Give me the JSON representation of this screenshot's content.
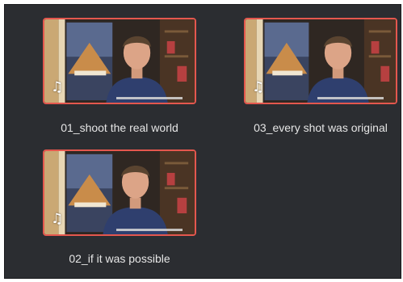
{
  "media_pool": {
    "clips": [
      {
        "name": "01_shoot the real world",
        "audio_icon": "music-note-icon",
        "selected": true
      },
      {
        "name": "03_every shot was original",
        "audio_icon": "music-note-icon",
        "selected": true
      },
      {
        "name": "02_if it was possible",
        "audio_icon": "music-note-icon",
        "selected": true
      }
    ]
  },
  "colors": {
    "panel_bg": "#2b2d31",
    "selection_border": "#e4574e",
    "label_text": "#e6e6e6"
  }
}
